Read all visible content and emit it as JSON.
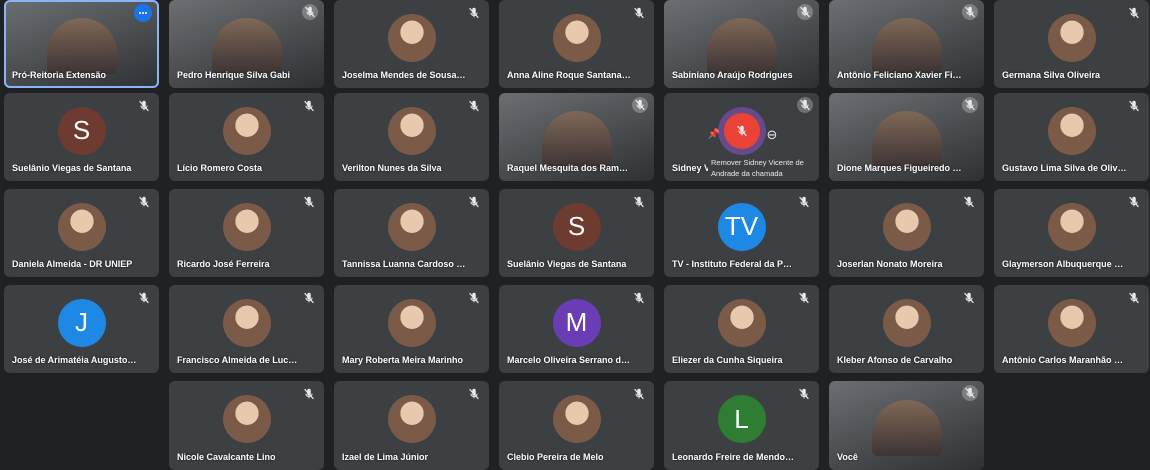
{
  "tiles": [
    {
      "name": "Pró-Reitoria Extensão",
      "kind": "video",
      "self_pin": true,
      "more": true
    },
    {
      "name": "Pedro Henrique Silva Gabi",
      "kind": "video"
    },
    {
      "name": "Joselma Mendes de Sousa Carn...",
      "kind": "photo"
    },
    {
      "name": "Anna Aline Roque Santana Dantas",
      "kind": "photo"
    },
    {
      "name": "Sabiniano Araújo Rodrigues",
      "kind": "video"
    },
    {
      "name": "Antônio Feliciano Xavier Filho",
      "kind": "video"
    },
    {
      "name": "Germana Silva Oliveira",
      "kind": "photo"
    },
    {
      "name": "Suelânio Viegas de Santana",
      "kind": "letter",
      "letter": "S",
      "color": "#6d3b2f"
    },
    {
      "name": "Lício Romero Costa",
      "kind": "photo"
    },
    {
      "name": "Verilton Nunes da Silva",
      "kind": "photo"
    },
    {
      "name": "Raquel Mesquita dos Ramos San...",
      "kind": "video"
    },
    {
      "name": "Sidney V...",
      "kind": "hover",
      "tooltip": "Remover Sidney Vicente de Andrade da chamada"
    },
    {
      "name": "Dione Marques Figueiredo Gued...",
      "kind": "video"
    },
    {
      "name": "Gustavo Lima Silva de Oliveira",
      "kind": "photo"
    },
    {
      "name": "Daniela Almeida - DR UNIEP",
      "kind": "photo"
    },
    {
      "name": "Ricardo José Ferreira",
      "kind": "photo"
    },
    {
      "name": "Tannissa Luanna Cardoso de Ara...",
      "kind": "photo"
    },
    {
      "name": "Suelânio Viegas de Santana",
      "kind": "letter",
      "letter": "S",
      "color": "#6d3b2f"
    },
    {
      "name": "TV - Instituto Federal da Paraíba",
      "kind": "letter",
      "letter": "TV",
      "color": "#1e88e5"
    },
    {
      "name": "Joserlan Nonato Moreira",
      "kind": "photo"
    },
    {
      "name": "Glaymerson Albuquerque de Fra...",
      "kind": "photo"
    },
    {
      "name": "José de Arimatéia Augusto de Li...",
      "kind": "letter",
      "letter": "J",
      "color": "#1e88e5"
    },
    {
      "name": "Francisco Almeida de Lucena",
      "kind": "photo"
    },
    {
      "name": "Mary Roberta Meira Marinho",
      "kind": "photo"
    },
    {
      "name": "Marcelo Oliveira Serrano de And...",
      "kind": "letter",
      "letter": "M",
      "color": "#6a3db5"
    },
    {
      "name": "Eliezer da Cunha Siqueira",
      "kind": "photo"
    },
    {
      "name": "Kleber Afonso de Carvalho",
      "kind": "photo"
    },
    {
      "name": "Antônio Carlos Maranhão Neto",
      "kind": "photo"
    },
    {
      "name": "Nicole Cavalcante Lino",
      "kind": "photo"
    },
    {
      "name": "Izael de Lima Júnior",
      "kind": "photo"
    },
    {
      "name": "Clebio Pereira de Melo",
      "kind": "photo"
    },
    {
      "name": "Leonardo Freire de Mendonça S...",
      "kind": "letter",
      "letter": "L",
      "color": "#2e7d32"
    },
    {
      "name": "Você",
      "kind": "video",
      "self": true
    }
  ],
  "colors": {
    "background": "#202124",
    "tile": "#3c4043",
    "accent": "#1a73e8"
  }
}
